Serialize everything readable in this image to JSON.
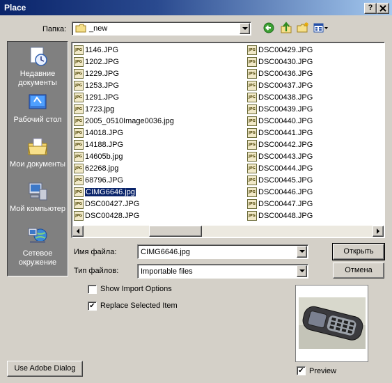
{
  "window": {
    "title": "Place",
    "help_btn": "?",
    "close_btn": "X"
  },
  "toolbar": {
    "folder_label": "Папка:",
    "folder_value": "_new",
    "back_icon": "back-arrow-icon",
    "up_icon": "up-folder-icon",
    "newfolder_icon": "new-folder-icon",
    "views_icon": "view-menu-icon"
  },
  "places": [
    {
      "label": "Недавние документы",
      "icon": "recent-documents-icon"
    },
    {
      "label": "Рабочий стол",
      "icon": "desktop-icon"
    },
    {
      "label": "Мои документы",
      "icon": "my-documents-icon"
    },
    {
      "label": "Мой компьютер",
      "icon": "my-computer-icon"
    },
    {
      "label": "Сетевое окружение",
      "icon": "network-icon"
    }
  ],
  "files": {
    "col1": [
      "1146.JPG",
      "1202.JPG",
      "1229.JPG",
      "1253.JPG",
      "1291.JPG",
      "1723.jpg",
      "2005_0510Image0036.jpg",
      "14018.JPG",
      "14188.JPG",
      "14605b.jpg",
      "62268.jpg",
      "68796.JPG",
      "CIMG6646.jpg",
      "DSC00427.JPG",
      "DSC00428.JPG"
    ],
    "col2": [
      "DSC00429.JPG",
      "DSC00430.JPG",
      "DSC00436.JPG",
      "DSC00437.JPG",
      "DSC00438.JPG",
      "DSC00439.JPG",
      "DSC00440.JPG",
      "DSC00441.JPG",
      "DSC00442.JPG",
      "DSC00443.JPG",
      "DSC00444.JPG",
      "DSC00445.JPG",
      "DSC00446.JPG",
      "DSC00447.JPG",
      "DSC00448.JPG"
    ],
    "selected": "CIMG6646.jpg",
    "icon_text": "JPG"
  },
  "form": {
    "filename_label": "Имя файла:",
    "filename_value": "CIMG6646.jpg",
    "filetype_label": "Тип файлов:",
    "filetype_value": "Importable files",
    "open_button": "Открыть",
    "cancel_button": "Отмена"
  },
  "options": {
    "show_import_label": "Show Import Options",
    "show_import_checked": false,
    "replace_label": "Replace Selected Item",
    "replace_checked": true,
    "preview_label": "Preview",
    "preview_checked": true,
    "check_mark": "✔"
  },
  "footer": {
    "adobe_dialog_button": "Use Adobe Dialog"
  }
}
